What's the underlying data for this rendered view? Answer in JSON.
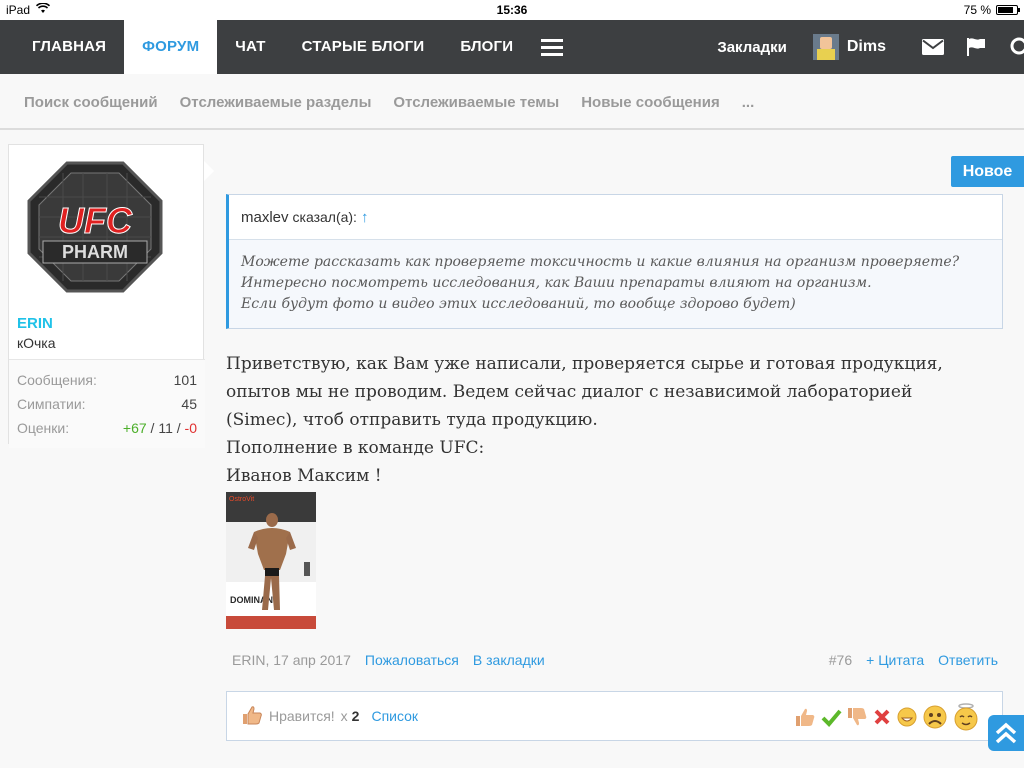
{
  "status_bar": {
    "device": "iPad",
    "time": "15:36",
    "battery": "75 %"
  },
  "nav": {
    "tabs": [
      {
        "label": "ГЛАВНАЯ"
      },
      {
        "label": "ФОРУМ"
      },
      {
        "label": "ЧАТ"
      },
      {
        "label": "СТАРЫЕ БЛОГИ"
      },
      {
        "label": "БЛОГИ"
      }
    ],
    "bookmarks": "Закладки",
    "user": "Dims"
  },
  "subnav": [
    "Поиск сообщений",
    "Отслеживаемые разделы",
    "Отслеживаемые темы",
    "Новые сообщения",
    "..."
  ],
  "user_card": {
    "name": "ERIN",
    "title": "кОчка",
    "avatar_text_top": "UFC",
    "avatar_text_bottom": "PHARM",
    "stats": [
      {
        "label": "Сообщения:",
        "value": "101"
      },
      {
        "label": "Симпатии:",
        "value": "45"
      }
    ],
    "ratings_label": "Оценки:",
    "ratings_pos": "+67",
    "ratings_sep1": " / ",
    "ratings_mid": "11",
    "ratings_sep2": " / ",
    "ratings_neg": "-0"
  },
  "new_badge": "Новое",
  "quote": {
    "author": "maxlev",
    "said": "сказал(а):",
    "arrow": "↑",
    "lines": [
      "Можете рассказать как проверяете токсичность и какие влияния на организм проверяете?",
      "Интересно посмотреть исследования, как Ваши препараты влияют на организм.",
      "Если будут фото и видео этих исследований, то вообще здорово будет)"
    ]
  },
  "message": {
    "lines": [
      "Приветствую, как Вам уже написали, проверяется сырье и готовая продукция,",
      "опытов мы не проводим. Ведем сейчас диалог с независимой лабораторией",
      "(Simec), чтоб отправить туда продукцию.",
      "Пополнение в команде UFC:",
      "Иванов Максим !"
    ],
    "photo_text_1": "OstroVit",
    "photo_text_2": "DOMINANT"
  },
  "meta": {
    "author_date": "ERIN, 17 апр 2017",
    "report": "Пожаловаться",
    "bookmark": "В закладки",
    "post_number": "#76",
    "quote": "+ Цитата",
    "reply": "Ответить"
  },
  "likes": {
    "label": "Нравится!",
    "times": "x",
    "count": "2",
    "list": "Список"
  },
  "colors": {
    "accent": "#2f9ae0",
    "nav_bg": "#3d3f41",
    "username": "#20c2e8",
    "positive": "#4caf2a",
    "negative": "#e03030"
  }
}
